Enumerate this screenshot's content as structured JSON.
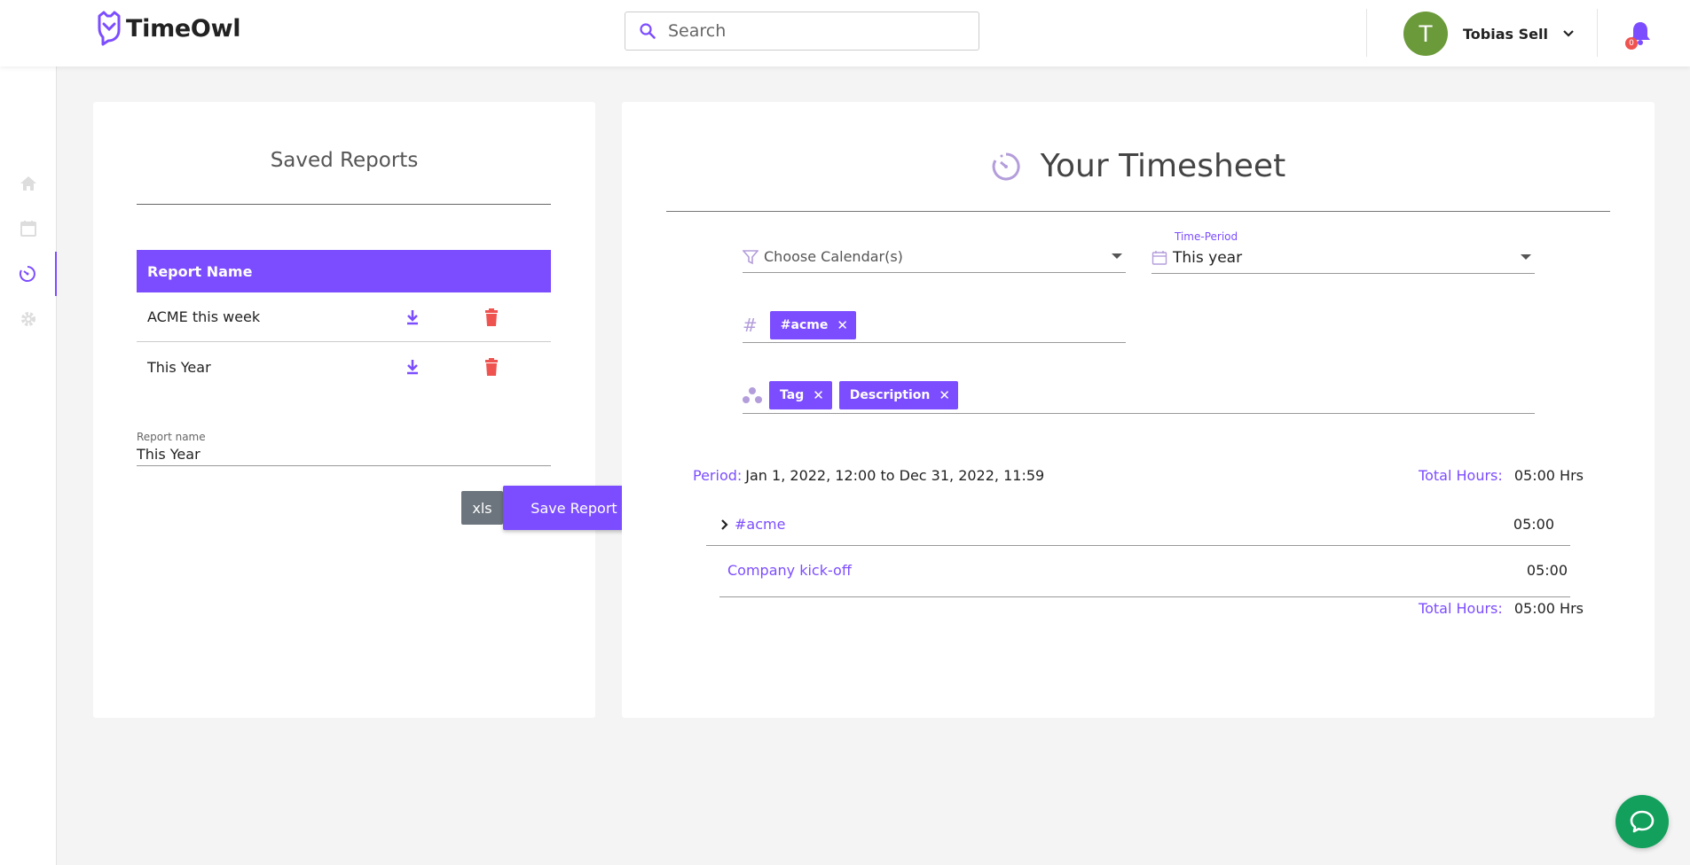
{
  "header": {
    "logo_text": "TimeOwl",
    "search_placeholder": "Search",
    "user_initial": "T",
    "user_name": "Tobias Sell",
    "notification_count": "0"
  },
  "colors": {
    "accent": "#7c4dff",
    "avatar": "#6b9a3a",
    "delete": "#ef5350",
    "chat": "#12a05c"
  },
  "sidebar": {
    "items": [
      {
        "icon": "home-icon"
      },
      {
        "icon": "calendar-icon"
      },
      {
        "icon": "timesheet-icon",
        "active": true
      },
      {
        "icon": "gear-icon"
      }
    ]
  },
  "saved_reports": {
    "title": "Saved Reports",
    "column_header": "Report Name",
    "rows": [
      {
        "name": "ACME this week"
      },
      {
        "name": "This Year"
      }
    ],
    "report_name_label": "Report name",
    "report_name_value": "This Year",
    "xls_label": "xls",
    "save_label": "Save Report"
  },
  "timesheet": {
    "title": "Your Timesheet",
    "calendar_placeholder": "Choose Calendar(s)",
    "time_period_label": "Time-Period",
    "time_period_value": "This year",
    "tag_chips": [
      "#acme"
    ],
    "group_chips": [
      "Tag",
      "Description"
    ],
    "period_label": "Period:",
    "period_value": "Jan 1, 2022, 12:00 to Dec 31, 2022, 11:59",
    "total_label": "Total Hours:",
    "total_value": "05:00 Hrs",
    "groups": [
      {
        "label": "#acme",
        "value": "05:00"
      }
    ],
    "items": [
      {
        "label": "Company kick-off",
        "value": "05:00"
      }
    ],
    "bottom_total_label": "Total Hours:",
    "bottom_total_value": "05:00 Hrs"
  }
}
